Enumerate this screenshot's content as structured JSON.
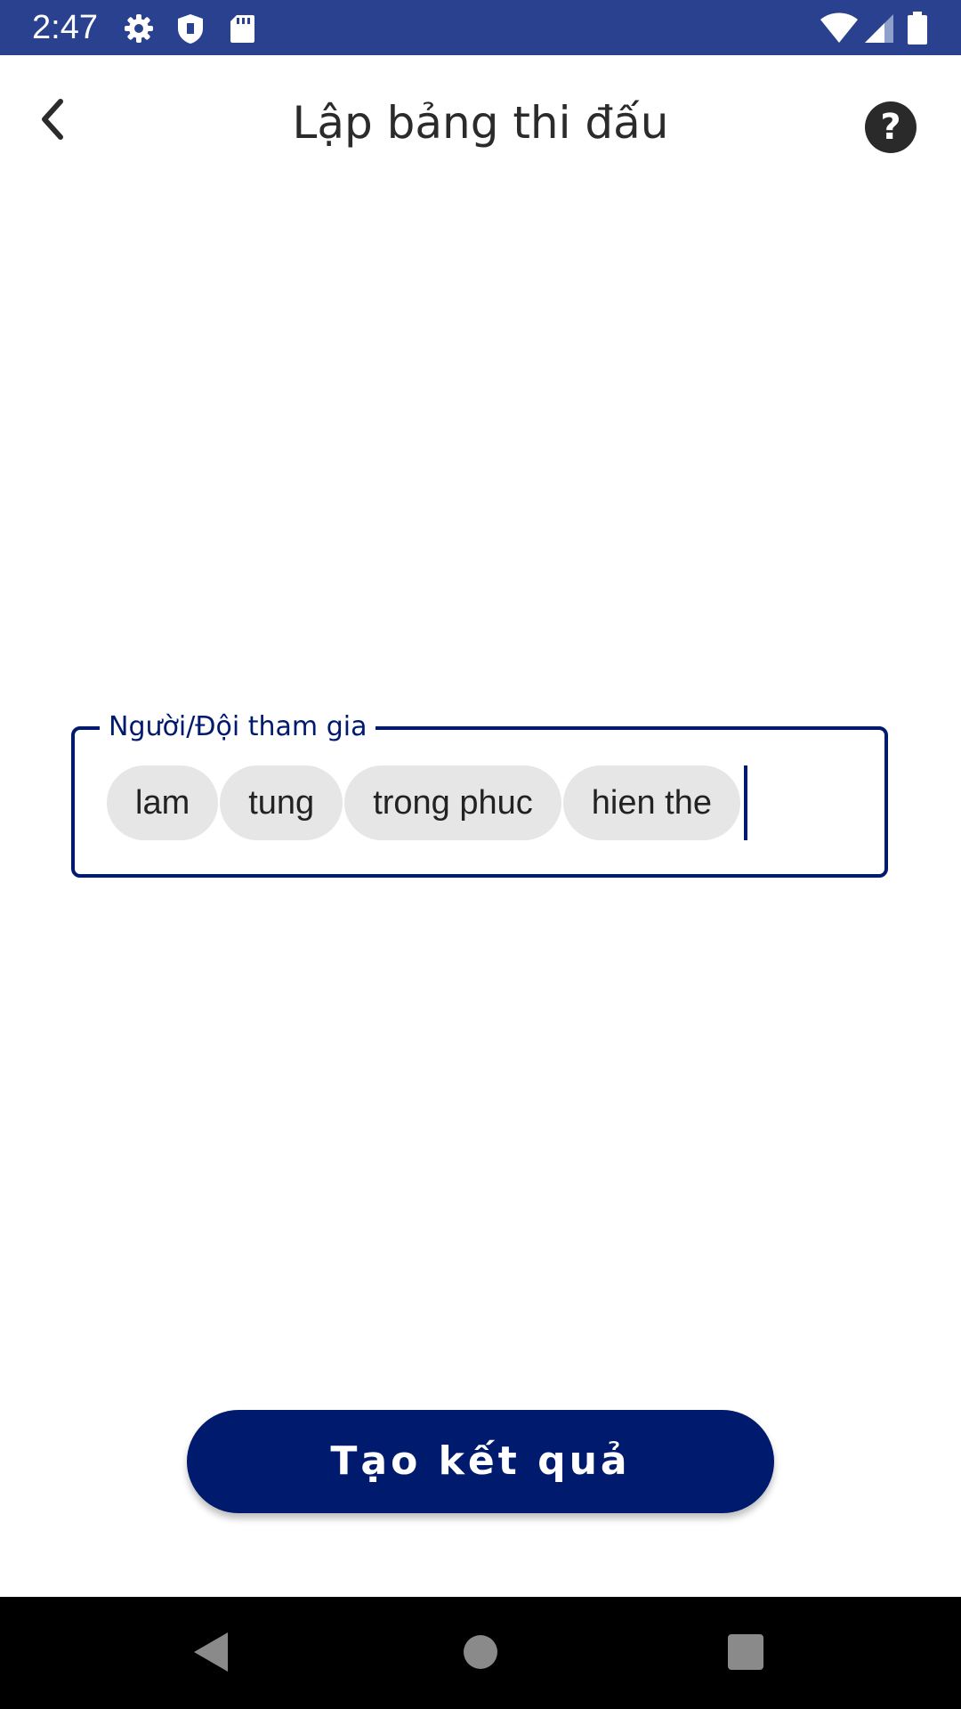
{
  "status_bar": {
    "time": "2:47",
    "background": "#2a4190",
    "icons": [
      "settings-icon",
      "shield-icon",
      "sd-card-icon",
      "wifi-icon",
      "cell-signal-icon",
      "battery-icon"
    ]
  },
  "header": {
    "title": "Lập bảng thi đấu",
    "back_icon": "chevron-left-icon",
    "help_label": "?"
  },
  "participants_field": {
    "label": "Người/Đội tham gia",
    "chips": [
      "lam",
      "tung",
      "trong phuc",
      "hien the"
    ],
    "accent": "#001a6e"
  },
  "actions": {
    "create_label": "Tạo kết quả",
    "button_color": "#001a6e"
  },
  "nav_bar": {
    "buttons": [
      "back-triangle-icon",
      "home-circle-icon",
      "recents-square-icon"
    ]
  }
}
